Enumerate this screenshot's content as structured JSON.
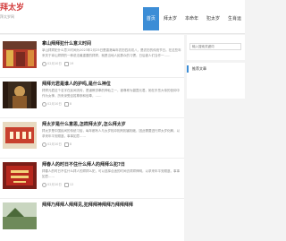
{
  "site": {
    "name": "拜太岁",
    "slogan": "拜太岁网"
  },
  "nav": [
    {
      "label": "首页",
      "active": true
    },
    {
      "label": "拜太岁",
      "active": false
    },
    {
      "label": "本命年",
      "active": false
    },
    {
      "label": "犯太岁",
      "active": false
    },
    {
      "label": "生肖运",
      "active": false
    }
  ],
  "breadcrumb": {
    "home": "首页"
  },
  "posts": [
    {
      "title": "拿山拜拜犯什么意义时间",
      "excerpt": "拿山拜拜犯什么意义时间为2023年2月25日是香港每年农历四月初八，是农历的传统节日。在这些年来关于拿山拜拜的一种说法最重要的拜拜，就是当地人民群众的习惯，日后被人们当作一……",
      "date": "02月10日",
      "views": "19"
    },
    {
      "title": "拜拜元君是谁人的护吗,是什么神位",
      "excerpt": "拜拜元君这个名字在民间流传，是道教供奉的神仙之一，被尊称为碧霞元君。她在东岳大帝的信仰中作为女神，历来深受百姓尊崇和信奉，……",
      "date": "02月10日",
      "views": "8"
    },
    {
      "title": "拜太岁是什么意思,怎样拜太岁,怎么拜太岁",
      "excerpt": "拜太岁是中国民间的传统习俗，每年都有人与太岁相冲相刑相害相破，因此需要进行拜太岁化解，以求来年平安顺遂，事事如意……",
      "date": "02月10日",
      "views": "8"
    },
    {
      "title": "拜春人的时日不住什么拜人的拜拜么犯?日",
      "excerpt": "拜春人的时日不住什么拜人的拜拜么犯，可以选择合适的时间去拜拜神明，以求来年平安顺遂，事事如意……",
      "date": "02月10日",
      "views": "12"
    },
    {
      "title": "拜拜乃拜拜人拜拜见,犯拜拜神拜拜乃拜拜拜拜",
      "excerpt": "",
      "date": "",
      "views": ""
    }
  ],
  "sidebar": {
    "search_placeholder": "输入搜索关键词",
    "recommend_title": "推荐文章"
  },
  "colors": {
    "accent": "#3c8dd6",
    "brand": "#d23b3b"
  }
}
